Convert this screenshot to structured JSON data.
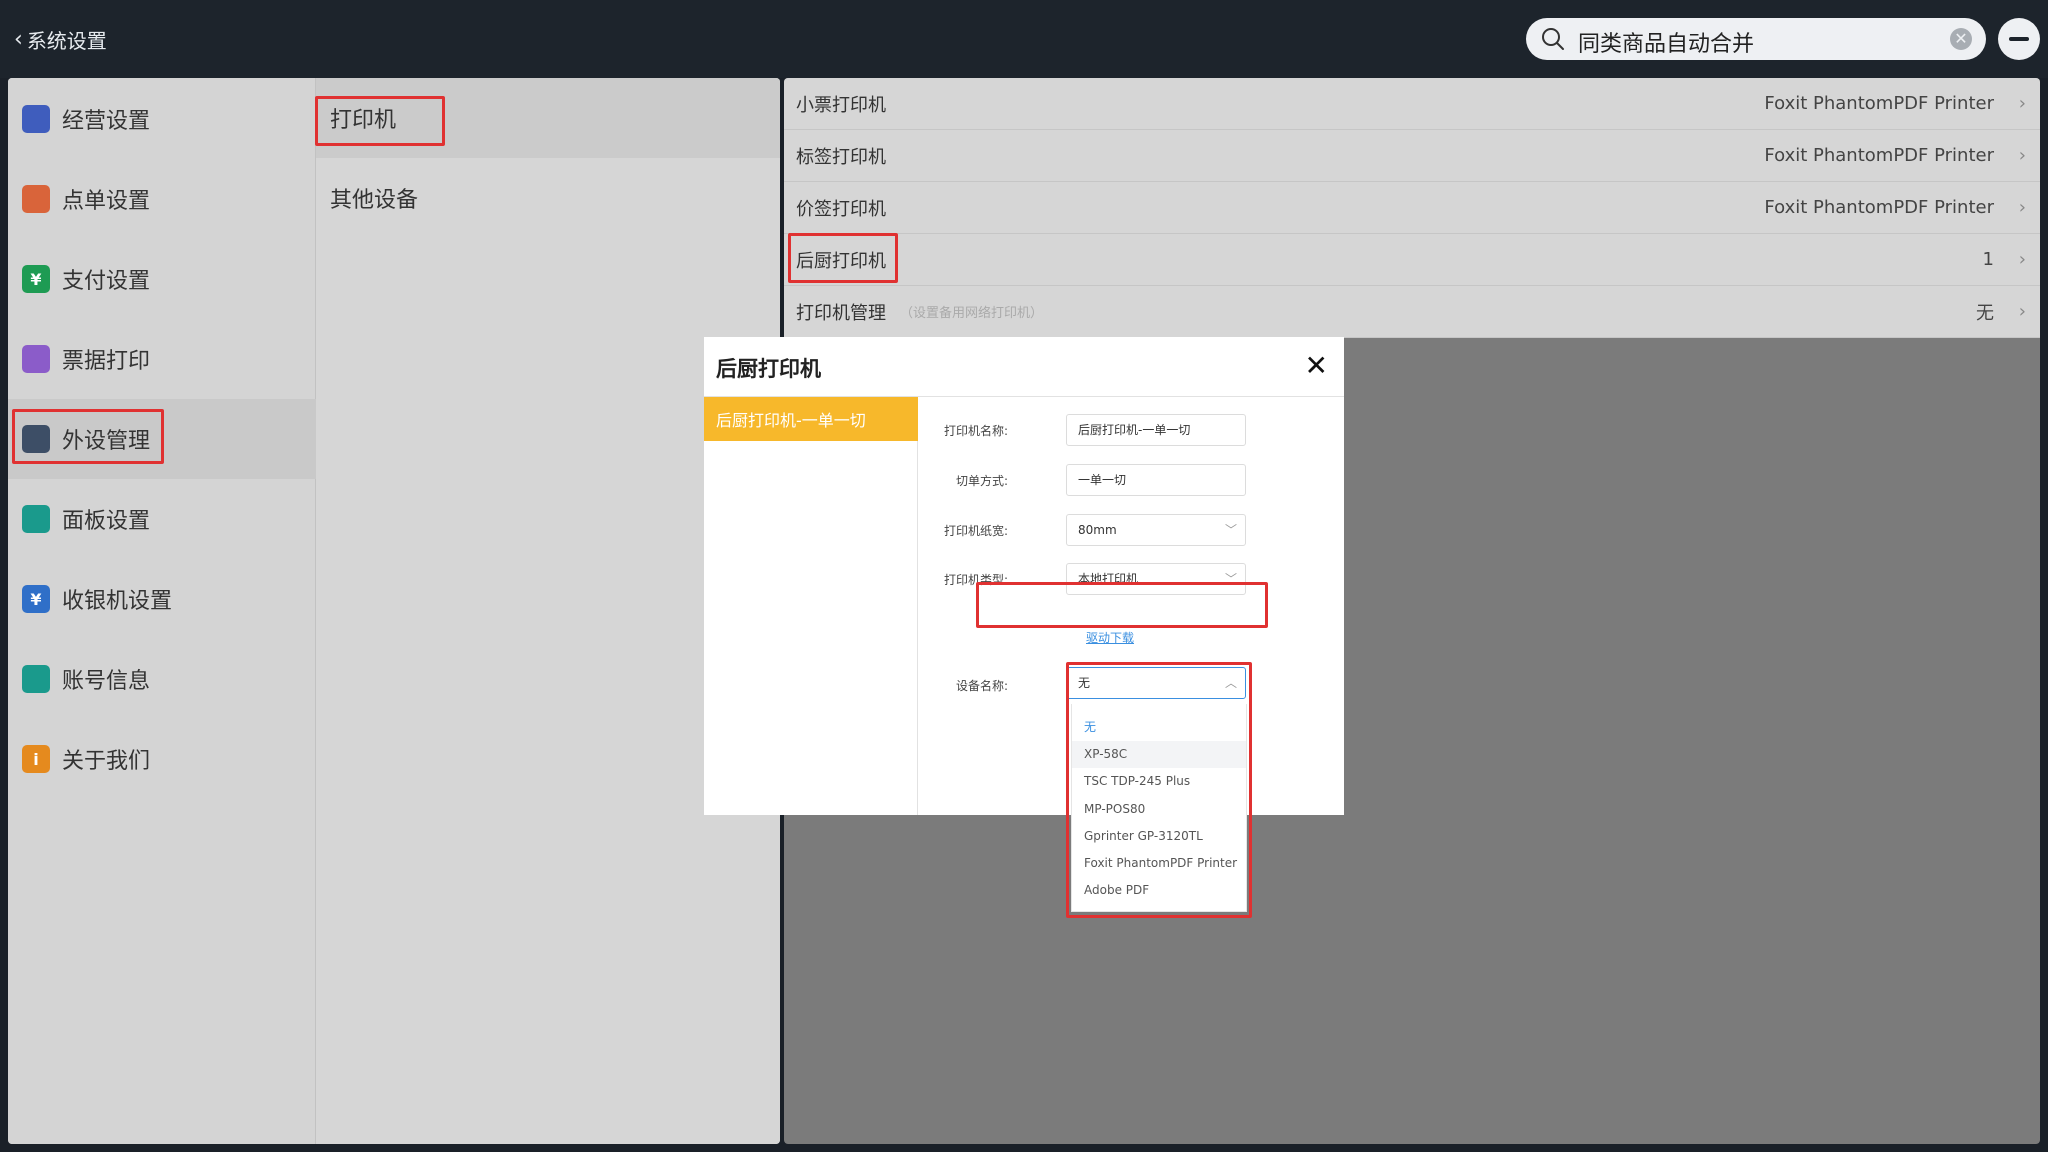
{
  "topbar": {
    "back_label": "系统设置",
    "search_value": "同类商品自动合并"
  },
  "menu": [
    {
      "label": "经营设置",
      "icon": "store-settings-icon",
      "color": "#3f5dbd"
    },
    {
      "label": "点单设置",
      "icon": "order-settings-icon",
      "color": "#d9643a"
    },
    {
      "label": "支付设置",
      "icon": "payment-settings-icon",
      "color": "#1e9b53",
      "glyph": "¥"
    },
    {
      "label": "票据打印",
      "icon": "receipt-print-icon",
      "color": "#8b5cc9"
    },
    {
      "label": "外设管理",
      "icon": "peripheral-management-icon",
      "color": "#3d4e66"
    },
    {
      "label": "面板设置",
      "icon": "panel-settings-icon",
      "color": "#1a9a8c"
    },
    {
      "label": "收银机设置",
      "icon": "cashier-settings-icon",
      "color": "#2f6fc8",
      "glyph": "¥"
    },
    {
      "label": "账号信息",
      "icon": "account-info-icon",
      "color": "#1a9a8c"
    },
    {
      "label": "关于我们",
      "icon": "about-icon",
      "color": "#e58a1e",
      "glyph": "i"
    }
  ],
  "submenu": [
    {
      "label": "打印机"
    },
    {
      "label": "其他设备"
    }
  ],
  "printer_rows": [
    {
      "label": "小票打印机",
      "hint": "",
      "value": "Foxit PhantomPDF Printer"
    },
    {
      "label": "标签打印机",
      "hint": "",
      "value": "Foxit PhantomPDF Printer"
    },
    {
      "label": "价签打印机",
      "hint": "",
      "value": "Foxit PhantomPDF Printer"
    },
    {
      "label": "后厨打印机",
      "hint": "",
      "value": "1"
    },
    {
      "label": "打印机管理",
      "hint": "（设置备用网络打印机）",
      "value": "无"
    }
  ],
  "dialog": {
    "title": "后厨打印机",
    "close": "✕",
    "side_item": "后厨打印机-一单一切",
    "fields": {
      "name_label": "打印机名称:",
      "name_value": "后厨打印机-一单一切",
      "cut_label": "切单方式:",
      "cut_value": "一单一切",
      "paper_label": "打印机纸宽:",
      "paper_value": "80mm",
      "type_label": "打印机类型:",
      "type_value": "本地打印机",
      "driver_link": "驱动下载",
      "device_label": "设备名称:",
      "device_value": "无"
    },
    "device_options": [
      "无",
      "XP-58C",
      "TSC TDP-245 Plus",
      "MP-POS80",
      "Gprinter GP-3120TL",
      "Foxit PhantomPDF Printer",
      "Adobe PDF"
    ],
    "selected_option": "无",
    "hovered_option": "XP-58C"
  },
  "colors": {
    "highlight": "#e03131",
    "accent": "#f7b82b",
    "link": "#3a8fe0"
  }
}
